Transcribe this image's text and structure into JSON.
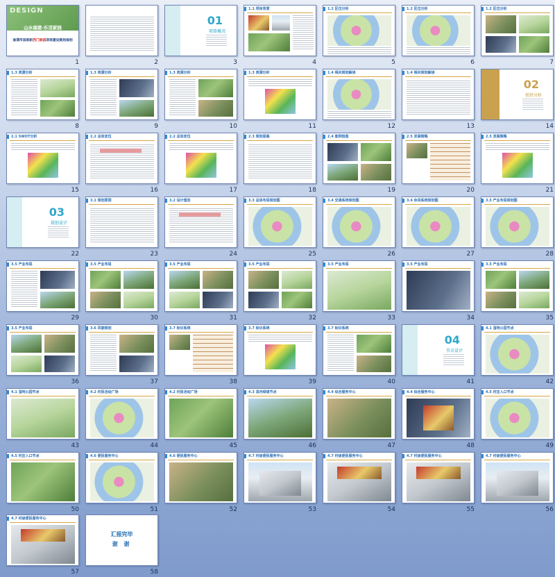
{
  "cover": {
    "logo": "DESIGN",
    "title": "山水福德·乐活家园",
    "subtitle_a": "渝漂市首家新",
    "subtitle_red": "西门家园",
    "subtitle_b": "项目建设策划规划"
  },
  "section_slides": {
    "s3": {
      "number": "01",
      "name": "项目概况"
    },
    "s14": {
      "number": "02",
      "name": "现状分析"
    },
    "s22": {
      "number": "03",
      "name": "规划设计"
    },
    "s41": {
      "number": "04",
      "name": "节点设计"
    }
  },
  "ending": {
    "line1": "汇报完毕",
    "line2": "谢 谢"
  },
  "slides": [
    {
      "n": "1",
      "header": ""
    },
    {
      "n": "2",
      "header": ""
    },
    {
      "n": "3",
      "header": ""
    },
    {
      "n": "4",
      "header": "1.1 项目背景"
    },
    {
      "n": "5",
      "header": "1.2 区位分析"
    },
    {
      "n": "6",
      "header": "1.2 区位分析"
    },
    {
      "n": "7",
      "header": "1.2 区位分析"
    },
    {
      "n": "8",
      "header": "1.3 资源分析"
    },
    {
      "n": "9",
      "header": "1.3 资源分析"
    },
    {
      "n": "10",
      "header": "1.3 资源分析"
    },
    {
      "n": "11",
      "header": "1.3 资源分析"
    },
    {
      "n": "12",
      "header": "1.4 相关规划解读"
    },
    {
      "n": "13",
      "header": "1.4 相关规划解读"
    },
    {
      "n": "14",
      "header": ""
    },
    {
      "n": "15",
      "header": "2.1 SWOT分析"
    },
    {
      "n": "16",
      "header": "2.2 总体定位"
    },
    {
      "n": "17",
      "header": "2.2 总体定位"
    },
    {
      "n": "18",
      "header": "2.3 规划思路"
    },
    {
      "n": "19",
      "header": "2.4 案例借鉴"
    },
    {
      "n": "20",
      "header": "2.5 发展策略"
    },
    {
      "n": "21",
      "header": "2.5 发展策略"
    },
    {
      "n": "22",
      "header": ""
    },
    {
      "n": "23",
      "header": "3.1 规划原则"
    },
    {
      "n": "24",
      "header": "3.2 设计理念"
    },
    {
      "n": "25",
      "header": "3.3 总体布局规划图"
    },
    {
      "n": "26",
      "header": "3.4 交通系统规划图"
    },
    {
      "n": "27",
      "header": "3.4 休闲系统规划图"
    },
    {
      "n": "28",
      "header": "3.5 产业布局规划图"
    },
    {
      "n": "29",
      "header": "3.5 产业布局"
    },
    {
      "n": "30",
      "header": "3.5 产业布局"
    },
    {
      "n": "31",
      "header": "3.5 产业布局"
    },
    {
      "n": "32",
      "header": "3.5 产业布局"
    },
    {
      "n": "33",
      "header": "3.5 产业布局"
    },
    {
      "n": "34",
      "header": "3.5 产业布局"
    },
    {
      "n": "35",
      "header": "3.5 产业布局"
    },
    {
      "n": "36",
      "header": "3.5 产业布局"
    },
    {
      "n": "37",
      "header": "3.6 风貌规划"
    },
    {
      "n": "38",
      "header": "3.7 标识系统"
    },
    {
      "n": "39",
      "header": "3.7 标识系统"
    },
    {
      "n": "40",
      "header": "3.7 标识系统"
    },
    {
      "n": "41",
      "header": ""
    },
    {
      "n": "42",
      "header": "4.1 湿地公园节点"
    },
    {
      "n": "43",
      "header": "4.1 湿地公园节点"
    },
    {
      "n": "44",
      "header": "4.2 村民活动广场"
    },
    {
      "n": "45",
      "header": "4.2 村民活动广场"
    },
    {
      "n": "46",
      "header": "4.3 滨河绿道节点"
    },
    {
      "n": "47",
      "header": "4.4 综合服务中心"
    },
    {
      "n": "48",
      "header": "4.4 综合服务中心"
    },
    {
      "n": "49",
      "header": "4.5 村庄入口节点"
    },
    {
      "n": "50",
      "header": "4.5 村庄入口节点"
    },
    {
      "n": "51",
      "header": "4.6 便民服务中心"
    },
    {
      "n": "52",
      "header": "4.6 便民服务中心"
    },
    {
      "n": "53",
      "header": "4.7 村级便民服务中心"
    },
    {
      "n": "54",
      "header": "4.7 村级便民服务中心"
    },
    {
      "n": "55",
      "header": "4.7 村级便民服务中心"
    },
    {
      "n": "56",
      "header": "4.7 村级便民服务中心"
    },
    {
      "n": "57",
      "header": "4.7 村级便民服务中心"
    },
    {
      "n": "58",
      "header": ""
    }
  ]
}
